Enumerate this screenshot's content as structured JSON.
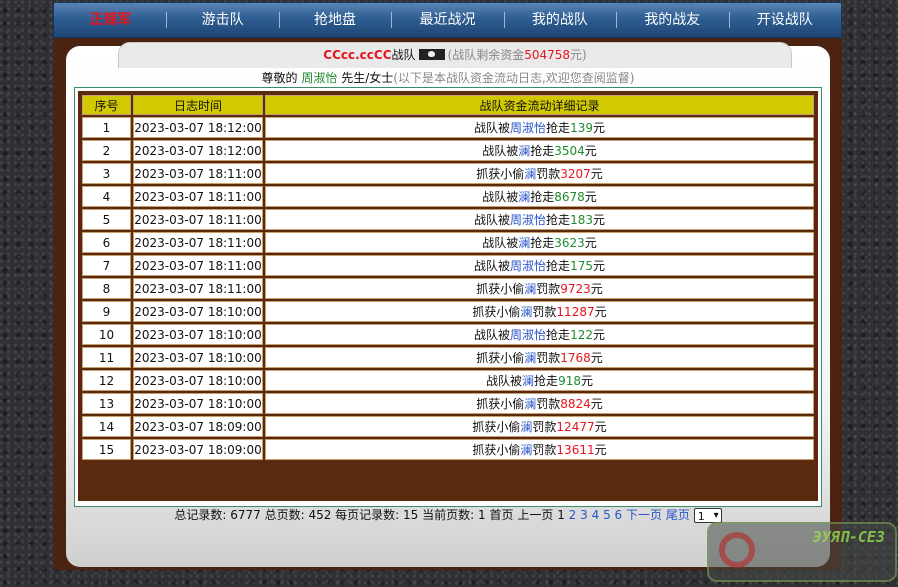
{
  "nav": {
    "items": [
      "正规军",
      "游击队",
      "抢地盘",
      "最近战况",
      "我的战队",
      "我的战友",
      "开设战队"
    ]
  },
  "header": {
    "team_name": "CCcc.ccCC",
    "team_suffix": "战队",
    "flag_icon": "pirate-flag-icon",
    "funds_prefix": "(战队剩余资金",
    "funds_value": "504758",
    "funds_suffix": "元)"
  },
  "greeting": {
    "prefix": "尊敬的",
    "user": "周淑怡",
    "title": "先生/女士",
    "note": "(以下是本战队资金流动日志,欢迎您查阅监督)"
  },
  "table": {
    "headers": [
      "序号",
      "日志时间",
      "战队资金流动详细记录"
    ],
    "rows": [
      {
        "no": "1",
        "time": "2023-03-07 18:12:00",
        "a": "战队被",
        "who": "周淑怡",
        "b": "抢走",
        "amt": "139",
        "c": "元"
      },
      {
        "no": "2",
        "time": "2023-03-07 18:12:00",
        "a": "战队被",
        "who": "澜",
        "b": "抢走",
        "amt": "3504",
        "c": "元"
      },
      {
        "no": "3",
        "time": "2023-03-07 18:11:00",
        "a": "抓获小偷",
        "who": "澜",
        "b": "罚款",
        "amt": "3207",
        "c": "元"
      },
      {
        "no": "4",
        "time": "2023-03-07 18:11:00",
        "a": "战队被",
        "who": "澜",
        "b": "抢走",
        "amt": "8678",
        "c": "元"
      },
      {
        "no": "5",
        "time": "2023-03-07 18:11:00",
        "a": "战队被",
        "who": "周淑怡",
        "b": "抢走",
        "amt": "183",
        "c": "元"
      },
      {
        "no": "6",
        "time": "2023-03-07 18:11:00",
        "a": "战队被",
        "who": "澜",
        "b": "抢走",
        "amt": "3623",
        "c": "元"
      },
      {
        "no": "7",
        "time": "2023-03-07 18:11:00",
        "a": "战队被",
        "who": "周淑怡",
        "b": "抢走",
        "amt": "175",
        "c": "元"
      },
      {
        "no": "8",
        "time": "2023-03-07 18:11:00",
        "a": "抓获小偷",
        "who": "澜",
        "b": "罚款",
        "amt": "9723",
        "c": "元"
      },
      {
        "no": "9",
        "time": "2023-03-07 18:10:00",
        "a": "抓获小偷",
        "who": "澜",
        "b": "罚款",
        "amt": "11287",
        "c": "元"
      },
      {
        "no": "10",
        "time": "2023-03-07 18:10:00",
        "a": "战队被",
        "who": "周淑怡",
        "b": "抢走",
        "amt": "122",
        "c": "元"
      },
      {
        "no": "11",
        "time": "2023-03-07 18:10:00",
        "a": "抓获小偷",
        "who": "澜",
        "b": "罚款",
        "amt": "1768",
        "c": "元"
      },
      {
        "no": "12",
        "time": "2023-03-07 18:10:00",
        "a": "战队被",
        "who": "澜",
        "b": "抢走",
        "amt": "918",
        "c": "元"
      },
      {
        "no": "13",
        "time": "2023-03-07 18:10:00",
        "a": "抓获小偷",
        "who": "澜",
        "b": "罚款",
        "amt": "8824",
        "c": "元"
      },
      {
        "no": "14",
        "time": "2023-03-07 18:09:00",
        "a": "抓获小偷",
        "who": "澜",
        "b": "罚款",
        "amt": "12477",
        "c": "元"
      },
      {
        "no": "15",
        "time": "2023-03-07 18:09:00",
        "a": "抓获小偷",
        "who": "澜",
        "b": "罚款",
        "amt": "13611",
        "c": "元"
      }
    ]
  },
  "pager": {
    "total_label": "总记录数:",
    "total": "6777",
    "pages_label": "总页数:",
    "pages": "452",
    "per_label": "每页记录数:",
    "per": "15",
    "current_label": "当前页数:",
    "current": "1",
    "first": "首页",
    "prev": "上一页",
    "current_page": "1",
    "page_links": [
      "2",
      "3",
      "4",
      "5",
      "6"
    ],
    "next": "下一页",
    "last": "尾页",
    "select_value": "1"
  },
  "watermark": {
    "text": "ЭУЯП-СЕЗ"
  },
  "colors": {
    "nav_bg": "#2f5e92",
    "active_nav": "#e8141c",
    "header_row": "#d2c900",
    "frame": "#5a2a10",
    "money": "#1f8a2e",
    "money_fine": "#e8141c",
    "name": "#2a55c8"
  }
}
